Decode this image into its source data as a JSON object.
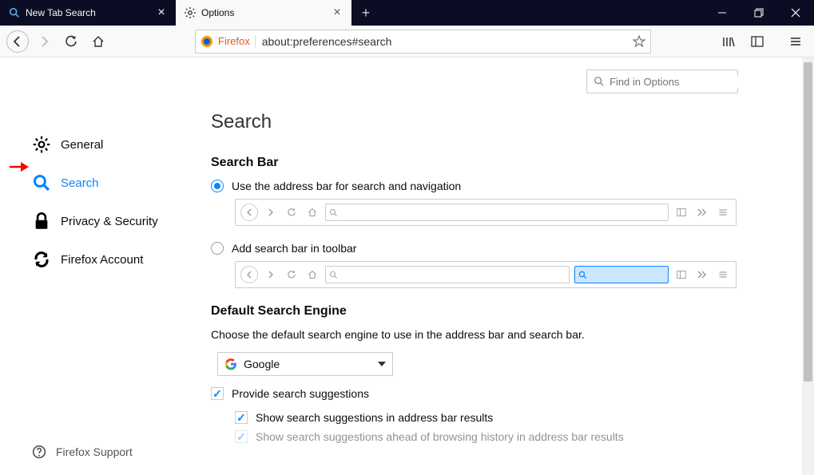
{
  "window": {
    "minimize": "–",
    "maximize": "❐",
    "close": "✕"
  },
  "tabs": [
    {
      "title": "New Tab Search",
      "active": false
    },
    {
      "title": "Options",
      "active": true
    }
  ],
  "urlbar": {
    "identity_label": "Firefox",
    "url": "about:preferences#search"
  },
  "toolbar_right": {},
  "find": {
    "placeholder": "Find in Options"
  },
  "sidebar": {
    "items": [
      {
        "key": "general",
        "label": "General"
      },
      {
        "key": "search",
        "label": "Search"
      },
      {
        "key": "privacy",
        "label": "Privacy & Security"
      },
      {
        "key": "account",
        "label": "Firefox Account"
      }
    ],
    "footer": "Firefox Support"
  },
  "content": {
    "title": "Search",
    "section_searchbar": {
      "heading": "Search Bar",
      "option_address": "Use the address bar for search and navigation",
      "option_separate": "Add search bar in toolbar"
    },
    "section_default": {
      "heading": "Default Search Engine",
      "desc": "Choose the default search engine to use in the address bar and search bar.",
      "selected": "Google",
      "check_suggestions": "Provide search suggestions",
      "check_addressbar": "Show search suggestions in address bar results",
      "check_history_cut": "Show search suggestions ahead of browsing history in address bar results"
    }
  }
}
